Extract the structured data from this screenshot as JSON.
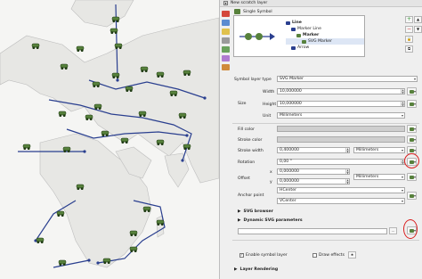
{
  "window": {
    "title": "New scratch layer"
  },
  "symbol": {
    "preview_label": "Single Symbol",
    "tree": [
      {
        "label": "Line",
        "level": 0
      },
      {
        "label": "Marker Line",
        "level": 1
      },
      {
        "label": "Marker",
        "level": 2
      },
      {
        "label": "SVG Marker",
        "level": 3
      },
      {
        "label": "Arrow",
        "level": 1
      }
    ]
  },
  "layer_type": {
    "label": "Symbol layer type",
    "value": "SVG Marker"
  },
  "size": {
    "group_label": "Size",
    "width_label": "Width",
    "width_value": "10,000000",
    "height_label": "Height",
    "height_value": "10,000000",
    "unit_label": "Unit",
    "unit_value": "Millimeters"
  },
  "fill_color": {
    "label": "Fill color"
  },
  "stroke_color": {
    "label": "Stroke color"
  },
  "stroke_width": {
    "label": "Stroke width",
    "value": "0,400000",
    "unit": "Millimeters"
  },
  "rotation": {
    "label": "Rotation",
    "value": "0,00 °"
  },
  "offset": {
    "label": "Offset",
    "x_label": "x",
    "x_value": "0,000000",
    "y_label": "y",
    "y_value": "0,000000",
    "unit": "Millimeters"
  },
  "anchor": {
    "label": "Anchor point",
    "h_value": "HCenter",
    "v_value": "VCenter"
  },
  "sections": {
    "svg_browser": "SVG browser",
    "dynamic_svg": "Dynamic SVG parameters",
    "layer_rendering": "Layer Rendering"
  },
  "options": {
    "enable_label": "Enable symbol layer",
    "draw_effects": "Draw effects"
  },
  "colors": {
    "marker": "#57813c",
    "route": "#2a3f8f",
    "highlight": "#d91f1f"
  }
}
